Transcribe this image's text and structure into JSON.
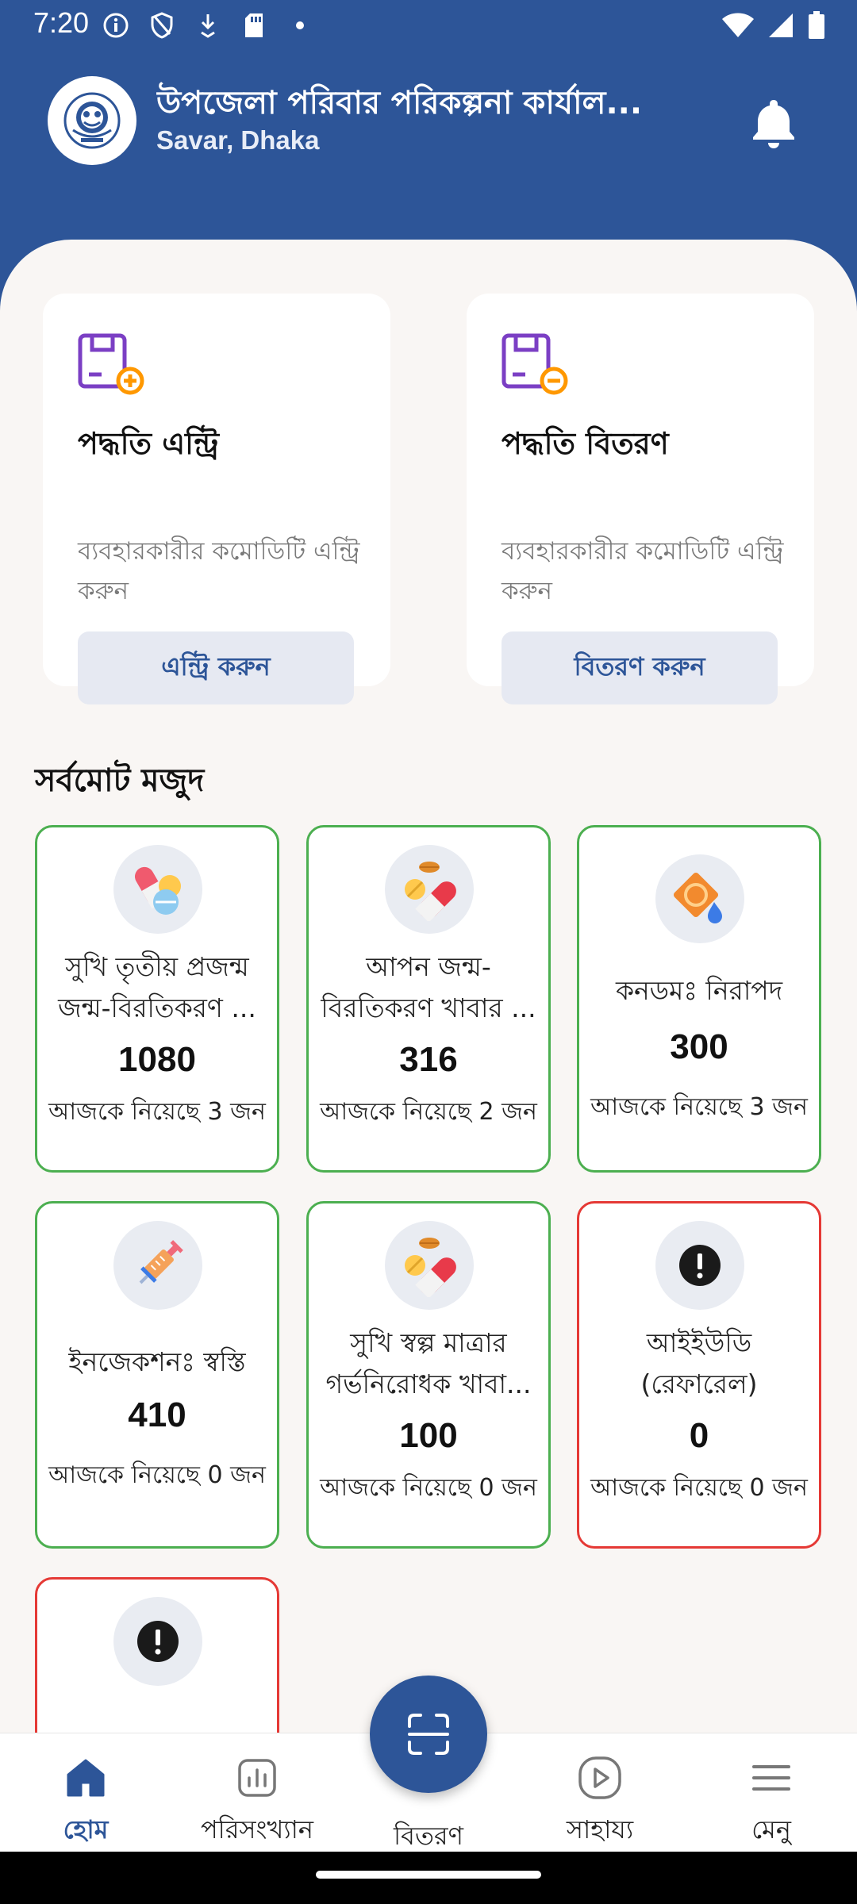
{
  "status_bar": {
    "time": "7:20",
    "left_icons": [
      "info-icon",
      "shield-icon",
      "download-icon",
      "sd-card-icon",
      "dot-icon"
    ],
    "right_icons": [
      "wifi-icon",
      "signal-icon",
      "battery-icon"
    ]
  },
  "header": {
    "title": "উপজেলা পরিবার পরিকল্পনা কার্যাল...",
    "subtitle": "Savar, Dhaka",
    "notification_icon": "bell-icon"
  },
  "colors": {
    "primary": "#2d5598",
    "card_ok_border": "#4caf50",
    "card_alert_border": "#e53935",
    "icon_purple": "#7b3fc4",
    "icon_orange": "#ff9800"
  },
  "actions": [
    {
      "icon": "box-plus-icon",
      "title": "পদ্ধতি এন্ট্রি",
      "description": "ব্যবহারকারীর কমোডিটি এন্ট্রি করুন",
      "button": "এন্ট্রি করুন"
    },
    {
      "icon": "box-minus-icon",
      "title": "পদ্ধতি বিতরণ",
      "description": "ব্যবহারকারীর কমোডিটি এন্ট্রি করুন",
      "button": "বিতরণ করুন"
    }
  ],
  "stock": {
    "title": "সর্বমোট মজুদ",
    "items": [
      {
        "icon": "pills-capsule-icon",
        "name": "সুখি তৃতীয় প্রজন্ম জন্ম-বিরতিকরণ ...",
        "count": "1080",
        "today": "আজকে নিয়েছে 3 জন",
        "status": "ok"
      },
      {
        "icon": "pill-tablet-icon",
        "name": "আপন জন্ম-বিরতিকরণ খাবার ...",
        "count": "316",
        "today": "আজকে নিয়েছে 2 জন",
        "status": "ok"
      },
      {
        "icon": "condom-icon",
        "name": "কনডমঃ নিরাপদ",
        "count": "300",
        "today": "আজকে নিয়েছে 3 জন",
        "status": "ok"
      },
      {
        "icon": "syringe-icon",
        "name": "ইনজেকশনঃ স্বস্তি",
        "count": "410",
        "today": "আজকে নিয়েছে 0 জন",
        "status": "ok"
      },
      {
        "icon": "pill-tablet-icon",
        "name": "সুখি স্বল্প মাত্রার গর্ভনিরোধক খাবা...",
        "count": "100",
        "today": "আজকে নিয়েছে 0 জন",
        "status": "ok"
      },
      {
        "icon": "alert-icon",
        "name": "আইইউডি (রেফারেল)",
        "count": "0",
        "today": "আজকে নিয়েছে 0 জন",
        "status": "alert"
      },
      {
        "icon": "alert-icon",
        "name": "",
        "count": "",
        "today": "",
        "status": "alert"
      }
    ]
  },
  "bottom_nav": {
    "items": [
      {
        "icon": "home-icon",
        "label": "হোম",
        "active": true
      },
      {
        "icon": "chart-icon",
        "label": "পরিসংখ্যান",
        "active": false
      },
      {
        "icon": "scan-icon",
        "label": "বিতরণ",
        "active": false
      },
      {
        "icon": "play-circle-icon",
        "label": "সাহায্য",
        "active": false
      },
      {
        "icon": "hamburger-menu-icon",
        "label": "মেনু",
        "active": false
      }
    ]
  }
}
